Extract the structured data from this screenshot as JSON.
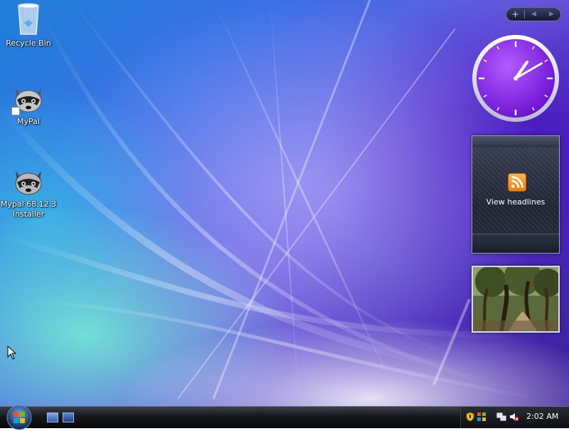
{
  "desktop": {
    "icons": [
      {
        "label": "Recycle Bin",
        "icon": "recycle-bin-icon"
      },
      {
        "label": "MyPal",
        "icon": "raccoon-app-icon"
      },
      {
        "label": "Mypal 68.12.3 Installer",
        "icon": "raccoon-installer-icon"
      }
    ]
  },
  "sidebar": {
    "add_gadget": "+",
    "prev": "◀",
    "next": "▶"
  },
  "clock_gadget": {
    "hour": 1,
    "minute": 10,
    "face_color": "#8a2be2"
  },
  "feed_gadget": {
    "label": "View headlines",
    "icon": "rss-feed-icon",
    "icon_color": "#f7941d"
  },
  "slideshow_gadget": {
    "icon": "forest-photo"
  },
  "taskbar": {
    "start_icon": "windows-orb-icon",
    "quick_launch": [
      "show-desktop-icon",
      "switch-windows-icon"
    ],
    "tray_icons": [
      "security-shield-icon",
      "network-icon",
      "volume-muted-icon"
    ],
    "clock": "2:02 AM"
  }
}
